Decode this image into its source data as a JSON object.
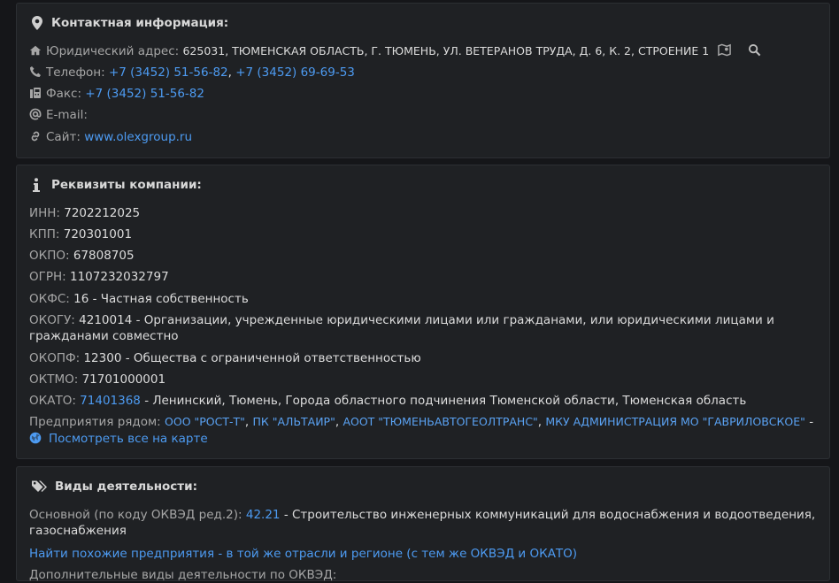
{
  "contact": {
    "title": "Контактная информация:",
    "address_label": "Юридический адрес:",
    "address_value": "625031, ТЮМЕНСКАЯ ОБЛАСТЬ, Г. ТЮМЕНЬ, УЛ. ВЕТЕРАНОВ ТРУДА, Д. 6, К. 2, СТРОЕНИЕ 1",
    "phone_label": "Телефон:",
    "phones": [
      "+7 (3452) 51-56-82",
      "+7 (3452) 69-69-53"
    ],
    "phone_sep": ",",
    "fax_label": "Факс:",
    "fax_value": "+7 (3452) 51-56-82",
    "email_label": "E-mail:",
    "site_label": "Сайт:",
    "site_value": "www.olexgroup.ru"
  },
  "requisites": {
    "title": "Реквизиты компании:",
    "inn_label": "ИНН:",
    "inn_value": "7202212025",
    "kpp_label": "КПП:",
    "kpp_value": "720301001",
    "okpo_label": "ОКПО:",
    "okpo_value": "67808705",
    "ogrn_label": "ОГРН:",
    "ogrn_value": "1107232032797",
    "okfs_label": "ОКФС:",
    "okfs_value": "16 - Частная собственность",
    "okogu_label": "ОКОГУ:",
    "okogu_value": "4210014 - Организации, учрежденные юридическими лицами или гражданами, или юридическими лицами и гражданами совместно",
    "okopf_label": "ОКОПФ:",
    "okopf_value": "12300 - Общества с ограниченной ответственностью",
    "oktmo_label": "ОКТМО:",
    "oktmo_value": "71701000001",
    "okato_label": "ОКАТО:",
    "okato_code": "71401368",
    "okato_value": "- Ленинский, Тюмень, Города областного подчинения Тюменской области, Тюменская область",
    "nearby_label": "Предприятия рядом:",
    "nearby": [
      "ООО \"РОСТ-Т\"",
      "ПК \"АЛЬТАИР\"",
      "АООТ \"ТЮМЕНЬАВТОГЕОЛТРАНС\"",
      "МКУ АДМИНИСТРАЦИЯ МО \"ГАВРИЛОВСКОЕ\""
    ],
    "nearby_sep": ",",
    "nearby_dash": "-",
    "map_link": "Посмотреть все на карте"
  },
  "activity": {
    "title": "Виды деятельности:",
    "main_label": "Основной (по коду ОКВЭД ред.2):",
    "main_code": "42.21",
    "main_value": "- Строительство инженерных коммуникаций для водоснабжения и водоотведения, газоснабжения",
    "similar_link": "Найти похожие предприятия - в той же отрасли и регионе (с тем же ОКВЭД и ОКАТО)",
    "additional_label": "Дополнительные виды деятельности по ОКВЭД:"
  },
  "icons": {
    "title_contact": "map-marker-icon",
    "title_requisites": "info-icon",
    "title_activity": "tags-icon",
    "address": "home-icon",
    "phone": "phone-icon",
    "fax": "fax-icon",
    "email": "at-icon",
    "site": "link-icon",
    "map": "map-icon",
    "search": "search-icon",
    "globe": "globe-icon"
  },
  "colors": {
    "background": "#151619",
    "card": "#1f2124",
    "link": "#4d9bf2",
    "text": "#d7d7d7",
    "label": "#a6a6a6"
  }
}
